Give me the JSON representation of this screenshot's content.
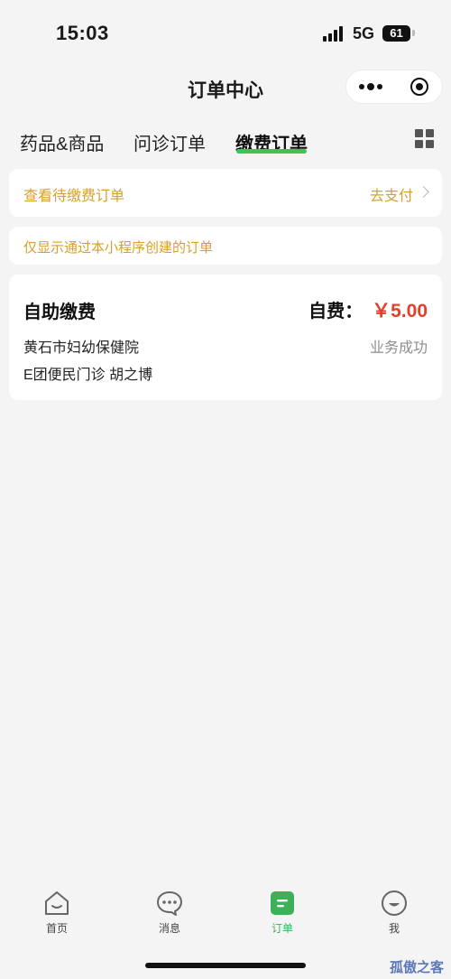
{
  "status_bar": {
    "time": "15:03",
    "network": "5G",
    "battery": "61"
  },
  "nav": {
    "title": "订单中心"
  },
  "tabs": [
    {
      "label": "药品&商品",
      "active": false
    },
    {
      "label": "问诊订单",
      "active": false
    },
    {
      "label": "缴费订单",
      "active": true
    }
  ],
  "pending": {
    "text": "查看待缴费订单",
    "action": "去支付"
  },
  "notice": {
    "text": "仅显示通过本小程序创建的订单"
  },
  "order": {
    "title": "自助缴费",
    "price_label": "自费：",
    "price": "￥5.00",
    "hospital": "黄石市妇幼保健院",
    "status": "业务成功",
    "dept_doctor": "E团便民门诊 胡之博"
  },
  "tabbar": [
    {
      "label": "首页",
      "icon": "home-icon",
      "active": false
    },
    {
      "label": "消息",
      "icon": "message-icon",
      "active": false
    },
    {
      "label": "订单",
      "icon": "order-icon",
      "active": true
    },
    {
      "label": "我",
      "icon": "profile-icon",
      "active": false
    }
  ],
  "watermark": "孤傲之客",
  "colors": {
    "accent": "#3fb058",
    "warning_text": "#d6a02e",
    "price": "#e0402c"
  }
}
